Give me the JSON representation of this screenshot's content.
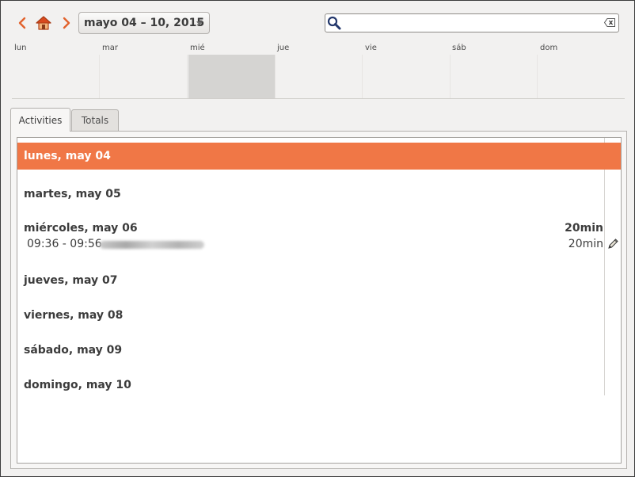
{
  "toolbar": {
    "prev_icon": "chevron-left-icon",
    "home_icon": "home-icon",
    "next_icon": "chevron-right-icon",
    "date_range": "mayo 04 – 10, 2015",
    "search": {
      "value": "",
      "placeholder": ""
    }
  },
  "week": {
    "days": [
      "lun",
      "mar",
      "mié",
      "jue",
      "vie",
      "sáb",
      "dom"
    ],
    "active_day_index": 2
  },
  "tabs": [
    {
      "label": "Activities",
      "active": true
    },
    {
      "label": "Totals",
      "active": false
    }
  ],
  "activities": {
    "days": [
      {
        "label": "lunes, may 04",
        "selected": true,
        "total": ""
      },
      {
        "label": "martes, may 05",
        "selected": false,
        "total": ""
      },
      {
        "label": "miércoles, may 06",
        "selected": false,
        "total": "20min",
        "fact": {
          "time": "09:36 - 09:56",
          "duration": "20min"
        }
      },
      {
        "label": "jueves, may 07",
        "selected": false,
        "total": ""
      },
      {
        "label": "viernes, may 08",
        "selected": false,
        "total": ""
      },
      {
        "label": "sábado, may 09",
        "selected": false,
        "total": ""
      },
      {
        "label": "domingo, may 10",
        "selected": false,
        "total": ""
      }
    ]
  },
  "colors": {
    "accent": "#f07746",
    "day_bar": "#d5d4d2"
  }
}
